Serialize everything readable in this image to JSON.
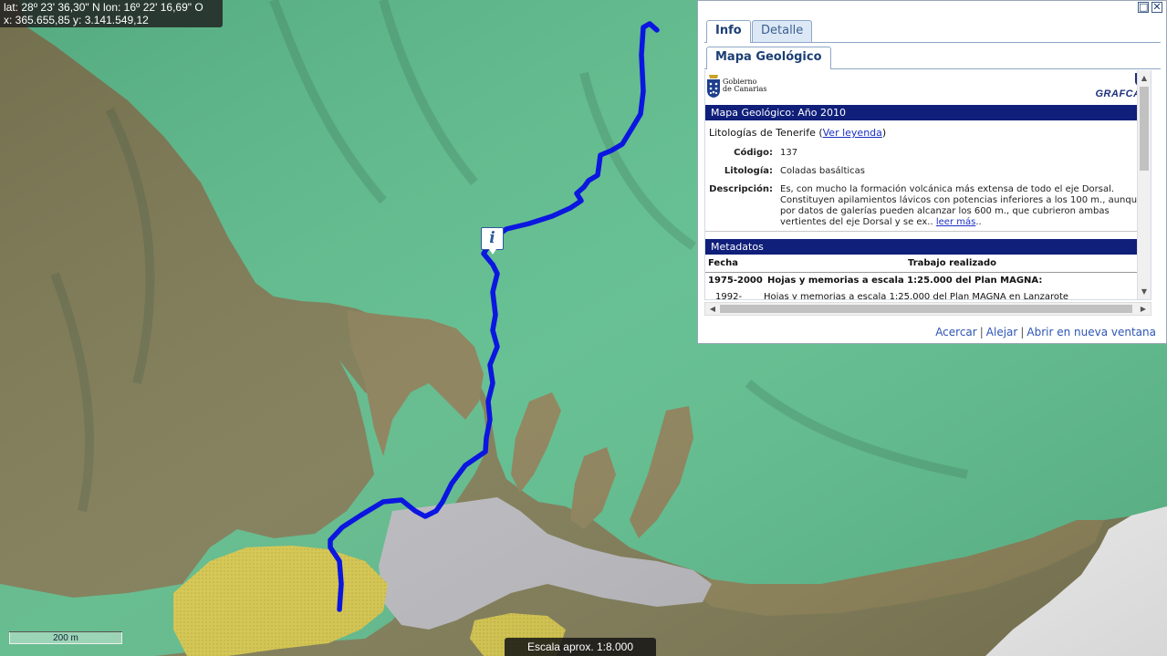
{
  "map": {
    "coords_line1": "lat: 28º 23' 36,30\" N  lon: 16º 22' 16,69\" O",
    "coords_line2": "x: 365.655,85  y: 3.141.549,12",
    "scalebar_label": "200 m",
    "scale_text": "Escala aprox. 1:8.000",
    "marker_glyph": "i",
    "colors": {
      "basalt_green": "#5fbf8e",
      "olive": "#7d7a55",
      "yellow": "#cfc24a",
      "grey": "#b9b9bd",
      "route": "#0b16e0"
    }
  },
  "panel": {
    "window_buttons": [
      "restore-icon",
      "close-icon"
    ],
    "tabs": [
      {
        "label": "Info",
        "active": true
      },
      {
        "label": "Detalle",
        "active": false
      }
    ],
    "subtab": "Mapa Geológico",
    "logos": {
      "gobierno_line1": "Gobierno",
      "gobierno_line2": "de Canarias",
      "grafcan": "GRAFCAN"
    },
    "section_title": "Mapa Geológico: Año 2010",
    "lit_prefix": "Litologías de Tenerife (",
    "lit_link": "Ver leyenda",
    "lit_suffix": ")",
    "fields": {
      "codigo_label": "Código:",
      "codigo_value": "137",
      "litologia_label": "Litología:",
      "litologia_value": "Coladas basálticas",
      "descripcion_label": "Descripción:",
      "descripcion_value": "Es, con mucho la formación volcánica más extensa de todo el eje Dorsal. Constituyen apilamientos lávicos con potencias inferiores a los 100 m., aunque por datos de galerías pueden alcanzar los 600 m., que cubrieron ambas vertientes del eje Dorsal y se ex..",
      "descripcion_more": "leer más",
      "descripcion_end": ".."
    },
    "metadatos": {
      "title": "Metadatos",
      "col_fecha": "Fecha",
      "col_trabajo": "Trabajo realizado",
      "rows": [
        {
          "fecha": "1975-2000",
          "trabajo": "Hojas y memorias a escala 1:25.000 del Plan MAGNA:"
        },
        {
          "fecha": "1992-",
          "trabajo": "Hojas y memorias a escala 1:25.000 del Plan MAGNA en Lanzarote"
        }
      ]
    },
    "links": {
      "acercar": "Acercar",
      "alejar": "Alejar",
      "abrir": "Abrir en nueva ventana",
      "sep": "|"
    }
  }
}
